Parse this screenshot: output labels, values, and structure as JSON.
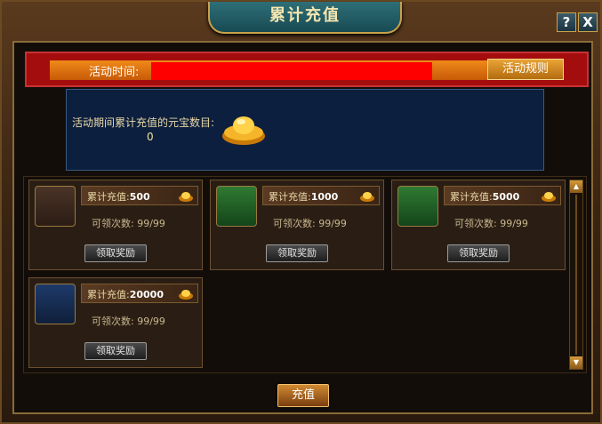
{
  "window": {
    "title": "累计充值",
    "help_label": "?",
    "close_label": "X"
  },
  "banner": {
    "time_label": "活动时间:",
    "rules_button": "活动规则"
  },
  "info": {
    "label": "活动期间累计充值的元宝数目:",
    "value": "0"
  },
  "rewards": [
    {
      "label": "累计充值:",
      "amount": "500",
      "count_text": "可领次数: 99/99",
      "button": "领取奖励",
      "chest": "brown-chest-icon"
    },
    {
      "label": "累计充值:",
      "amount": "1000",
      "count_text": "可领次数: 99/99",
      "button": "领取奖励",
      "chest": "green-chest-icon"
    },
    {
      "label": "累计充值:",
      "amount": "5000",
      "count_text": "可领次数: 99/99",
      "button": "领取奖励",
      "chest": "green-chest-icon"
    },
    {
      "label": "累计充值:",
      "amount": "20000",
      "count_text": "可领次数: 99/99",
      "button": "领取奖励",
      "chest": "gold-chest-icon"
    }
  ],
  "footer": {
    "recharge_button": "充值"
  },
  "colors": {
    "banner_red": "#a40d0d",
    "accent_gold": "#c9a24a",
    "info_blue": "#0d1f3e"
  }
}
